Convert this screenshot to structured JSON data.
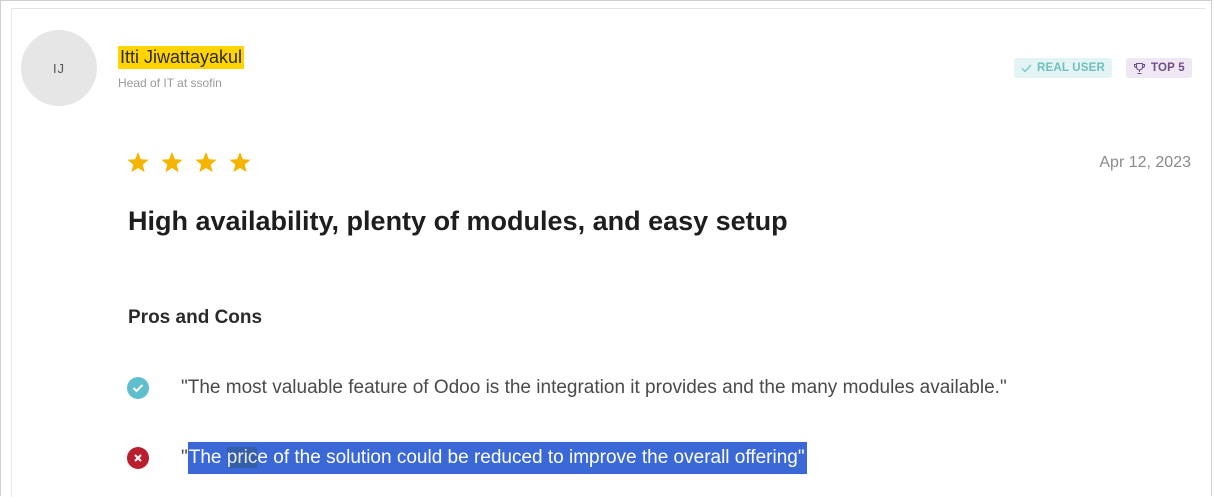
{
  "reviewer": {
    "initials": "IJ",
    "name": "Itti Jiwattayakul",
    "role": "Head of IT at ssofin"
  },
  "badges": {
    "real_user": "REAL USER",
    "top": "TOP 5"
  },
  "review": {
    "rating": 4,
    "date": "Apr 12, 2023",
    "title": "High availability, plenty of modules, and easy setup"
  },
  "pros_cons": {
    "heading": "Pros and Cons",
    "pro": "\"The most valuable feature of Odoo is the integration it provides and the many modules available.\"",
    "con_open_quote": "\"",
    "con_part1": "The ",
    "con_part2": "pric",
    "con_part3": "e of the solution could be reduced to improve the overall offering\""
  },
  "colors": {
    "name_highlight": "#ffd400",
    "star": "#f4b400",
    "pro_icon": "#5fbfcf",
    "con_icon": "#b91f2d",
    "selection": "#3a68d6"
  },
  "icons": {
    "real_user": "check-icon",
    "top": "trophy-icon",
    "pro": "check-circle-icon",
    "con": "x-circle-icon"
  }
}
